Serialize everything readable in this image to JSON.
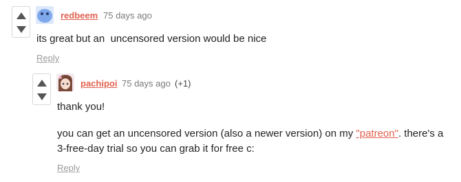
{
  "comment1": {
    "username": "redbeem",
    "time": "75 days ago",
    "body": "its great but an  uncensored version would be nice",
    "reply_label": "Reply",
    "avatar_icon": "blue-blob-avatar"
  },
  "comment2": {
    "username": "pachipoi",
    "time": "75 days ago",
    "score": "(+1)",
    "line1": "thank you!",
    "line2_before": "you can get an uncensored version (also a newer version) on my ",
    "link_text": "\"patreon\"",
    "line2_after": ". there's a",
    "line3": "3-free-day trial so you can grab it for free c:",
    "reply_label": "Reply",
    "avatar_icon": "anime-girl-avatar"
  },
  "colors": {
    "accent": "#e0604f",
    "meta": "#7a7a7a",
    "reply": "#9a9a9a",
    "vote_arrow": "#555555"
  }
}
